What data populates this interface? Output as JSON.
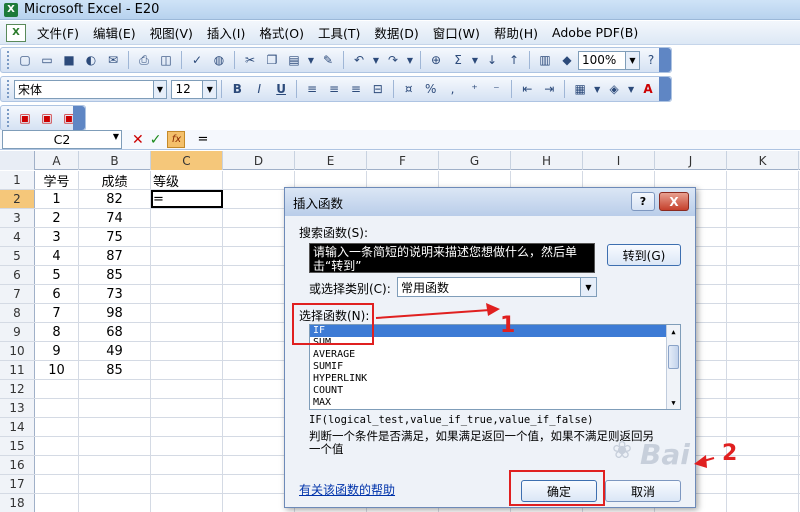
{
  "window": {
    "title": "Microsoft Excel - E20",
    "app_icon_glyph": "X"
  },
  "menu": {
    "doc_icon_glyph": "X",
    "items": [
      "文件(F)",
      "编辑(E)",
      "视图(V)",
      "插入(I)",
      "格式(O)",
      "工具(T)",
      "数据(D)",
      "窗口(W)",
      "帮助(H)",
      "Adobe PDF(B)"
    ]
  },
  "toolbar1": {
    "zoom": "100%",
    "icons": [
      "new-icon",
      "open-icon",
      "save-icon",
      "permission-icon",
      "email-icon",
      "print-icon",
      "print-preview-icon",
      "spelling-icon",
      "research-icon",
      "cut-icon",
      "copy-icon",
      "paste-icon",
      "format-painter-icon",
      "undo-icon",
      "redo-icon",
      "hyperlink-icon",
      "autosum-icon",
      "sort-asc-icon",
      "sort-desc-icon",
      "chart-wizard-icon",
      "drawing-icon",
      "help-icon"
    ]
  },
  "toolbar2": {
    "font_name": "宋体",
    "font_size": "12",
    "bold_label": "B",
    "italic_label": "I",
    "underline_label": "U",
    "percent_label": "%"
  },
  "formula_bar": {
    "name_box": "C2",
    "cancel_glyph": "✕",
    "enter_glyph": "✓",
    "fx_label": "fx",
    "content": "="
  },
  "grid": {
    "columns": [
      "A",
      "B",
      "C",
      "D",
      "E",
      "F",
      "G",
      "H",
      "I",
      "J",
      "K"
    ],
    "active_column": "C",
    "active_row": "2",
    "rows": [
      {
        "num": "1",
        "a": "学号",
        "b": "成绩",
        "c": "等级"
      },
      {
        "num": "2",
        "a": "1",
        "b": "82",
        "c": "="
      },
      {
        "num": "3",
        "a": "2",
        "b": "74",
        "c": ""
      },
      {
        "num": "4",
        "a": "3",
        "b": "75",
        "c": ""
      },
      {
        "num": "5",
        "a": "4",
        "b": "87",
        "c": ""
      },
      {
        "num": "6",
        "a": "5",
        "b": "85",
        "c": ""
      },
      {
        "num": "7",
        "a": "6",
        "b": "73",
        "c": ""
      },
      {
        "num": "8",
        "a": "7",
        "b": "98",
        "c": ""
      },
      {
        "num": "9",
        "a": "8",
        "b": "68",
        "c": ""
      },
      {
        "num": "10",
        "a": "9",
        "b": "49",
        "c": ""
      },
      {
        "num": "11",
        "a": "10",
        "b": "85",
        "c": ""
      },
      {
        "num": "12",
        "a": "",
        "b": "",
        "c": ""
      },
      {
        "num": "13",
        "a": "",
        "b": "",
        "c": ""
      },
      {
        "num": "14",
        "a": "",
        "b": "",
        "c": ""
      },
      {
        "num": "15",
        "a": "",
        "b": "",
        "c": ""
      },
      {
        "num": "16",
        "a": "",
        "b": "",
        "c": ""
      },
      {
        "num": "17",
        "a": "",
        "b": "",
        "c": ""
      },
      {
        "num": "18",
        "a": "",
        "b": "",
        "c": ""
      }
    ]
  },
  "dialog": {
    "title": "插入函数",
    "help_button": "?",
    "close_button": "X",
    "search_label": "搜索函数(S):",
    "search_value": "请输入一条简短的说明来描述您想做什么，然后单击“转到”",
    "goto_button": "转到(G)",
    "category_label": "或选择类别(C):",
    "category_value": "常用函数",
    "function_label": "选择函数(N):",
    "functions": [
      "IF",
      "SUM",
      "AVERAGE",
      "SUMIF",
      "HYPERLINK",
      "COUNT",
      "MAX"
    ],
    "selected_function": "IF",
    "signature": "IF(logical_test,value_if_true,value_if_false)",
    "description": "判断一个条件是否满足，如果满足返回一个值，如果不满足则返回另一个值",
    "help_link": "有关该函数的帮助",
    "ok_button": "确定",
    "cancel_button": "取消"
  },
  "annotations": {
    "step1_label": "1",
    "step2_label": "2",
    "color": "#e02020"
  },
  "watermark": {
    "text": "Bai"
  }
}
